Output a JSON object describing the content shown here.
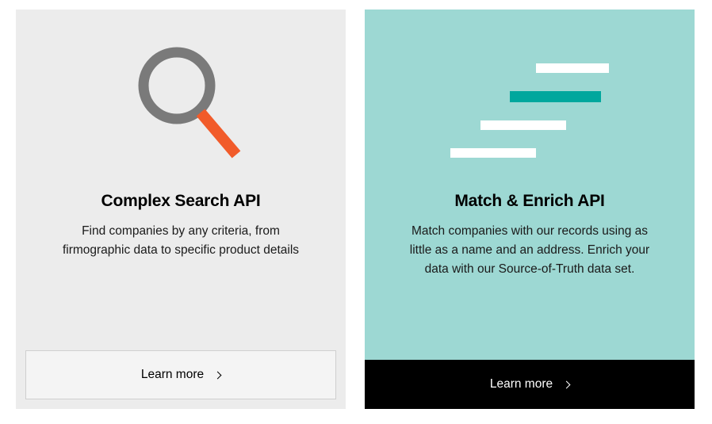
{
  "cards": [
    {
      "title": "Complex Search API",
      "description": "Find companies by any criteria, from firmographic data to specific product details",
      "button_label": "Learn more",
      "icon": "magnifying-glass-icon"
    },
    {
      "title": "Match & Enrich API",
      "description": "Match companies with our records using as little as a name and an address. Enrich your data with our Source-of-Truth data set.",
      "button_label": "Learn more",
      "icon": "staggered-bars-icon"
    }
  ],
  "colors": {
    "card_light_bg": "#ececec",
    "card_teal_bg": "#9dd8d3",
    "accent_orange": "#f15b2a",
    "accent_teal": "#00a79d",
    "icon_gray": "#7a7a7a"
  }
}
